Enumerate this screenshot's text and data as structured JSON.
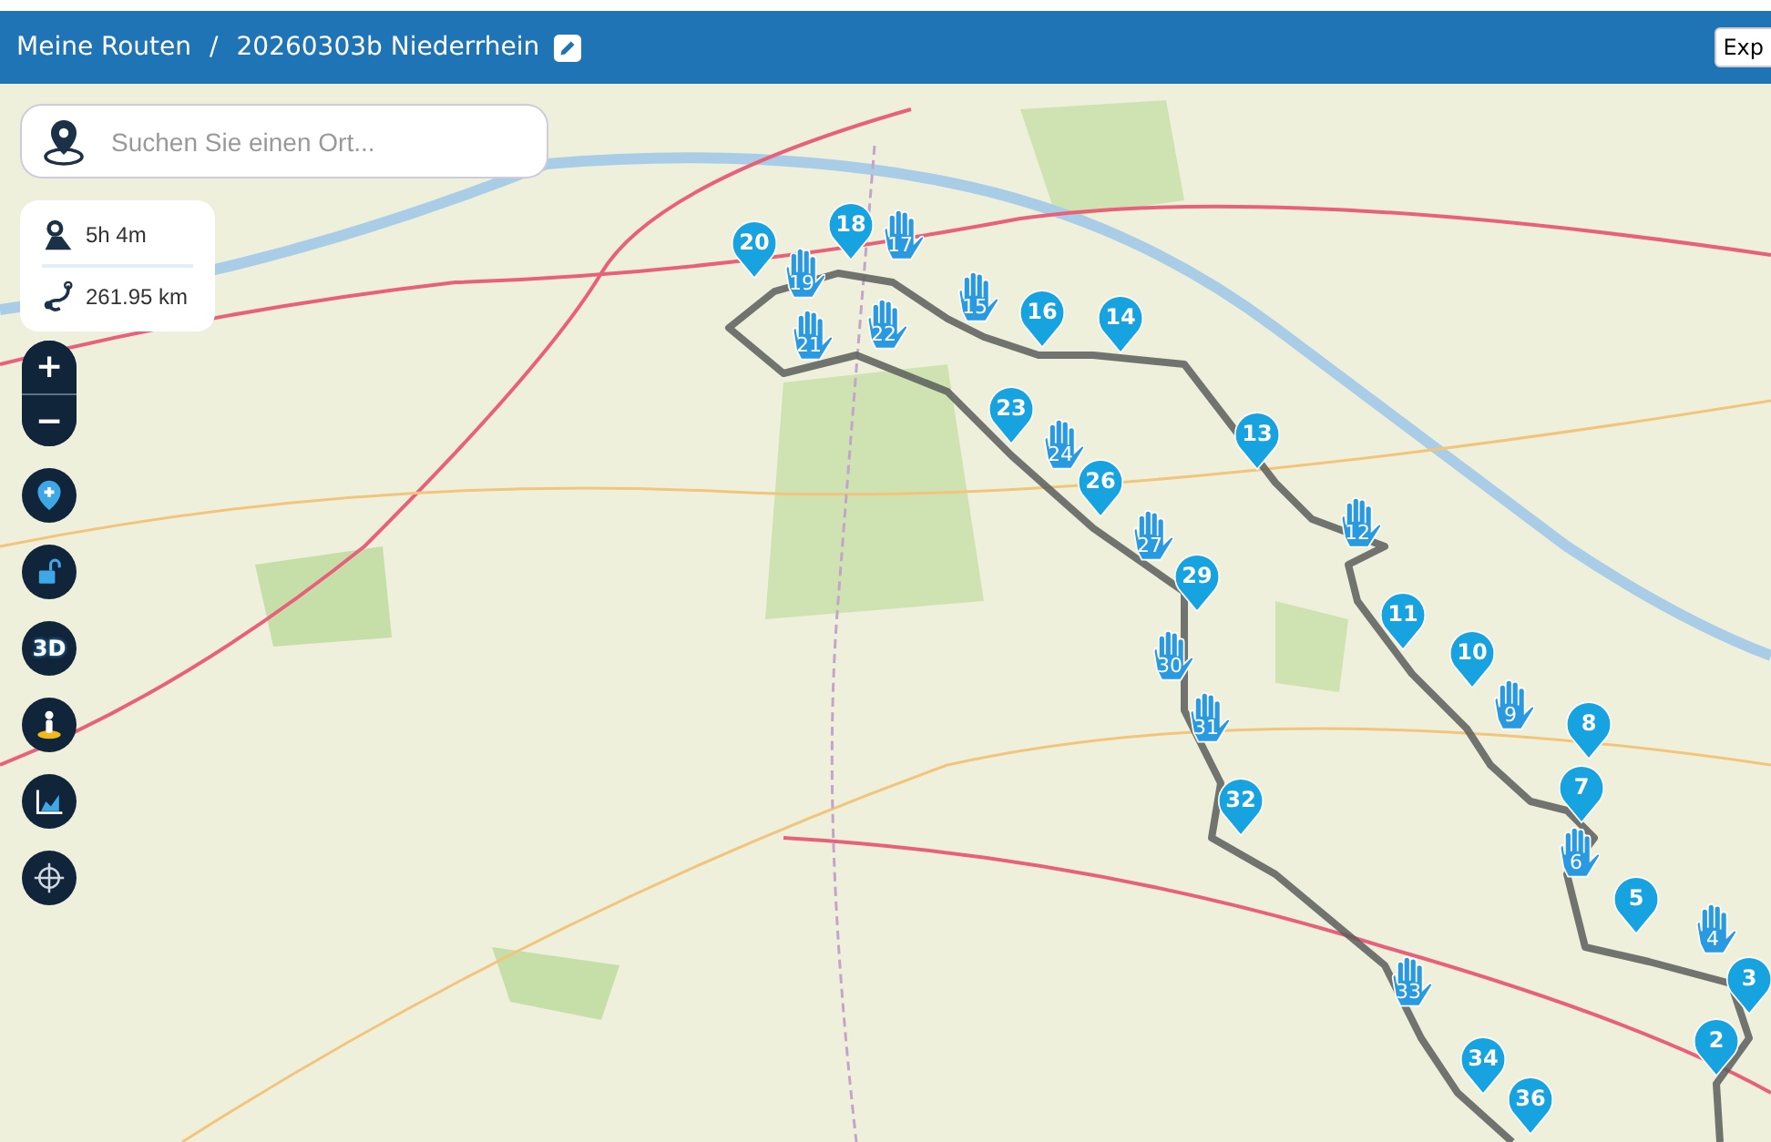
{
  "header": {
    "breadcrumb": [
      {
        "label": "Meine Routen"
      },
      {
        "label": "20260303b Niederrhein"
      }
    ],
    "separator": "/",
    "export_button": "Exp"
  },
  "search": {
    "placeholder": "Suchen Sie einen Ort..."
  },
  "stats": {
    "duration": "5h 4m",
    "distance": "261.95 km"
  },
  "map_controls": {
    "zoom_in": "+",
    "zoom_out": "−",
    "three_d": "3D"
  },
  "markers": [
    {
      "label": "20",
      "kind": "pin"
    },
    {
      "label": "19",
      "kind": "hand"
    },
    {
      "label": "18",
      "kind": "pin"
    },
    {
      "label": "17",
      "kind": "hand"
    },
    {
      "label": "21",
      "kind": "hand"
    },
    {
      "label": "22",
      "kind": "hand"
    },
    {
      "label": "15",
      "kind": "hand"
    },
    {
      "label": "16",
      "kind": "pin"
    },
    {
      "label": "14",
      "kind": "pin"
    },
    {
      "label": "23",
      "kind": "pin"
    },
    {
      "label": "24",
      "kind": "hand"
    },
    {
      "label": "13",
      "kind": "pin"
    },
    {
      "label": "26",
      "kind": "pin"
    },
    {
      "label": "27",
      "kind": "hand"
    },
    {
      "label": "29",
      "kind": "pin"
    },
    {
      "label": "12",
      "kind": "hand"
    },
    {
      "label": "11",
      "kind": "pin"
    },
    {
      "label": "10",
      "kind": "pin"
    },
    {
      "label": "9",
      "kind": "hand"
    },
    {
      "label": "8",
      "kind": "pin"
    },
    {
      "label": "7",
      "kind": "pin"
    },
    {
      "label": "6",
      "kind": "hand"
    },
    {
      "label": "30",
      "kind": "hand"
    },
    {
      "label": "31",
      "kind": "hand"
    },
    {
      "label": "32",
      "kind": "pin"
    },
    {
      "label": "5",
      "kind": "pin"
    },
    {
      "label": "4",
      "kind": "hand"
    },
    {
      "label": "3",
      "kind": "pin"
    },
    {
      "label": "33",
      "kind": "hand"
    },
    {
      "label": "2",
      "kind": "pin"
    },
    {
      "label": "34",
      "kind": "pin"
    },
    {
      "label": "36",
      "kind": "pin"
    }
  ]
}
